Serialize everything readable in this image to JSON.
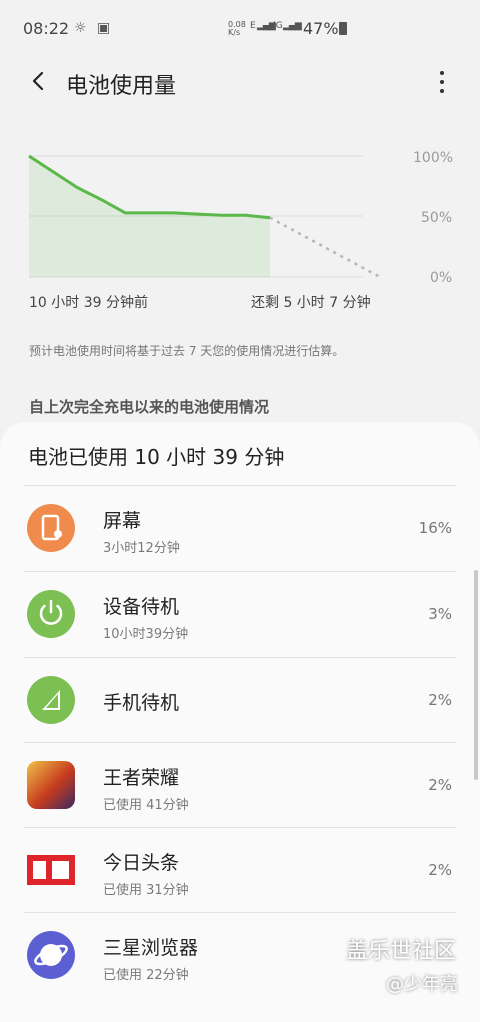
{
  "status_bar": {
    "time": "08:22",
    "net_speed": "0.08\nK/s",
    "net_type": "E",
    "net_type2": "4G",
    "battery": "47%"
  },
  "header": {
    "title": "电池使用量"
  },
  "chart": {
    "y_ticks": [
      "100%",
      "50%",
      "0%"
    ],
    "x_left": "10 小时 39 分钟前",
    "x_right": "还剩 5 小时 7 分钟",
    "line_color": "#5bb84a",
    "projection_color": "#b5b5b5"
  },
  "chart_data": {
    "type": "line",
    "series": [
      {
        "values": [
          100,
          87,
          74,
          64,
          53,
          53,
          53,
          52,
          51,
          51,
          49
        ]
      },
      {
        "values": [
          49,
          0
        ]
      }
    ],
    "ylim": [
      0,
      100
    ]
  },
  "estimate_note": "预计电池使用时间将基于过去 7 天您的使用情况进行估算。",
  "section_label": "自上次完全充电以来的电池使用情况",
  "summary": "电池已使用 10 小时 39 分钟",
  "apps": [
    {
      "name": "屏幕",
      "sub": "3小时12分钟",
      "pct": "16%",
      "icon": "screen-icon",
      "color": "#ef8b4c"
    },
    {
      "name": "设备待机",
      "sub": "10小时39分钟",
      "pct": "3%",
      "icon": "power-icon",
      "color": "#7cbf53"
    },
    {
      "name": "手机待机",
      "sub": "",
      "pct": "2%",
      "icon": "signal-icon",
      "color": "#7cbf53"
    },
    {
      "name": "王者荣耀",
      "sub": "已使用 41分钟",
      "pct": "2%",
      "icon": "game-icon",
      "color": "#c63b1e"
    },
    {
      "name": "今日头条",
      "sub": "已使用 31分钟",
      "pct": "2%",
      "icon": "toutiao-icon",
      "color": "#e0242c"
    },
    {
      "name": "三星浏览器",
      "sub": "已使用 22分钟",
      "pct": "",
      "icon": "browser-icon",
      "color": "#5b5fd1"
    }
  ],
  "watermark": {
    "line1": "盖乐世社区",
    "line2": "@少年亮"
  }
}
